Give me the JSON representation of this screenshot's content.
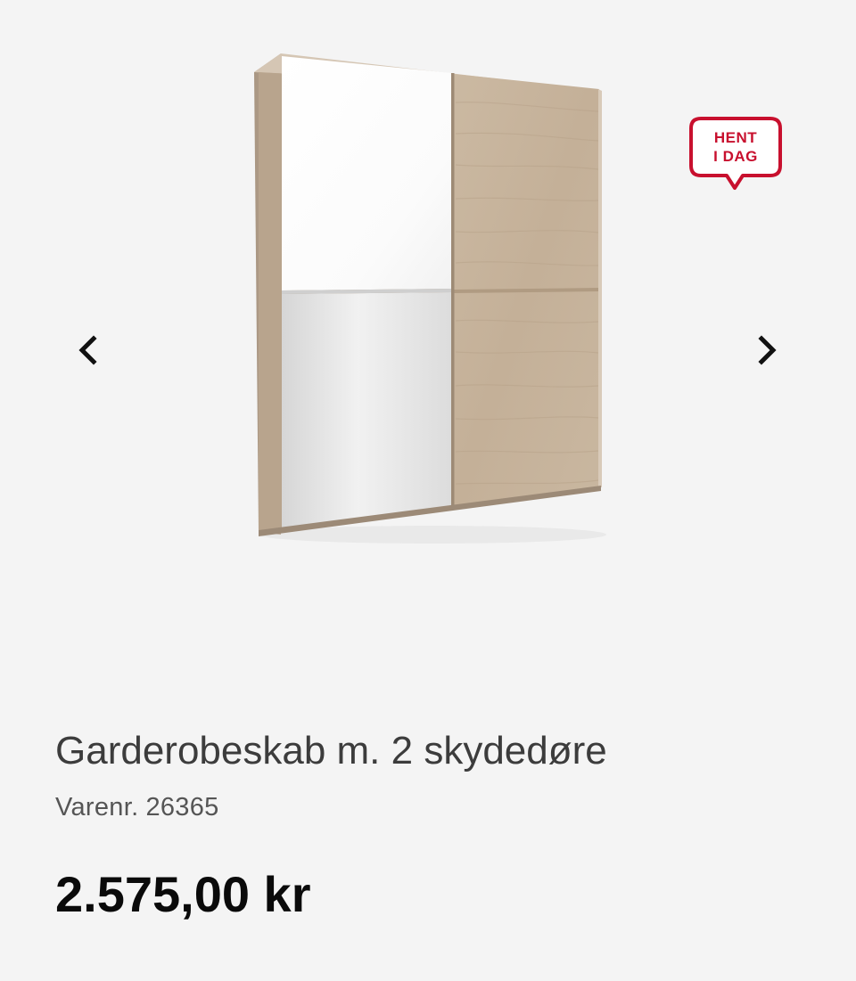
{
  "product": {
    "title": "Garderobeskab m. 2 skydedøre",
    "sku_label": "Varenr.",
    "sku_value": "26365",
    "price": "2.575,00 kr",
    "image_alt": "Garderobeskab m. 2 skydedøre"
  },
  "badge": {
    "line1": "HENT",
    "line2": "I DAG",
    "color": "#c8102e"
  },
  "gallery": {
    "prev_icon": "chevron-left-icon",
    "next_icon": "chevron-right-icon"
  },
  "colors": {
    "background": "#f4f4f4",
    "title_text": "#3c3c3c",
    "price_text": "#0a0a0a",
    "oak": "#c8b49b",
    "mirror": "#e6e6e6"
  }
}
